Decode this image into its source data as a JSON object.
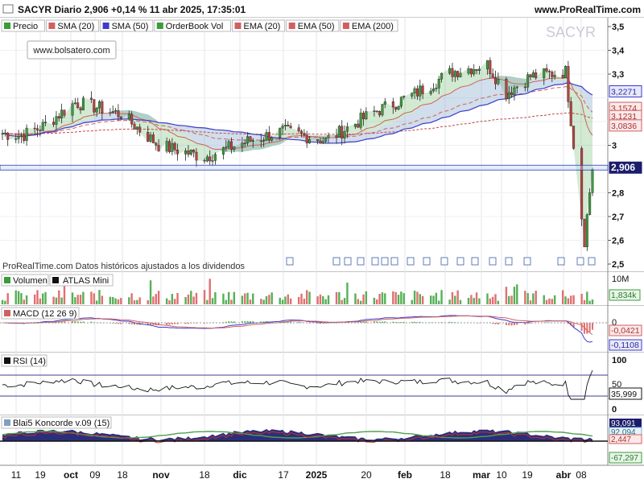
{
  "header": {
    "title": "SACYR Diario 2,906 +0,14 % 11 abr 2025, 17:35:01",
    "site": "www.ProRealTime.com"
  },
  "watermark": "SACYR",
  "source_box": "www.bolsatero.com",
  "disclaimer": "ProRealTime.com Datos históricos ajustados a los dividendos",
  "price_legend": [
    "Precio",
    "SMA (20)",
    "SMA (50)",
    "OrderBook Vol",
    "EMA (20)",
    "EMA (50)",
    "EMA (200)"
  ],
  "price_axis": {
    "ticks": [
      "3,5",
      "3,4",
      "3,3",
      "3",
      "2,8",
      "2,7",
      "2,6",
      "2,5"
    ],
    "badges": [
      "3,2271",
      "3,1574",
      "3,1231",
      "3,0836",
      "2,906"
    ]
  },
  "volume": {
    "legend": [
      "Volumen",
      "ATLAS Mini"
    ],
    "tick": "10M",
    "badge": "1,834k"
  },
  "macd": {
    "legend": "MACD (12 26 9)",
    "tick": "0",
    "badges": [
      "-0,0421",
      "-0,1108"
    ]
  },
  "rsi": {
    "legend": "RSI (14)",
    "ticks": [
      "100",
      "50",
      "0"
    ],
    "badge": "35,999"
  },
  "koncorde": {
    "legend": "Blai5 Koncorde v.09 (15)",
    "badges": [
      "93,091",
      "92,094",
      "2,447",
      "-67,297"
    ]
  },
  "x_axis": [
    "11",
    "19",
    "oct",
    "09",
    "18",
    "nov",
    "18",
    "dic",
    "17",
    "2025",
    "20",
    "feb",
    "18",
    "mar",
    "10",
    "19",
    "abr",
    "08"
  ],
  "colors": {
    "up": "#3c9b3c",
    "down": "#c04040",
    "sma50": "#3c3cc8",
    "ema": "#d06060",
    "price_badge": "#1c1c6c",
    "accent": "#2244aa"
  },
  "chart_data": {
    "type": "line",
    "title": "SACYR Diario",
    "series": [
      {
        "name": "Precio",
        "x": [
          "2024-09-11",
          "2024-09-19",
          "2024-10-01",
          "2024-10-09",
          "2024-10-18",
          "2024-11-01",
          "2024-11-18",
          "2024-12-02",
          "2024-12-17",
          "2025-01-02",
          "2025-01-20",
          "2025-02-03",
          "2025-02-18",
          "2025-03-03",
          "2025-03-10",
          "2025-03-19",
          "2025-04-01",
          "2025-04-08",
          "2025-04-11"
        ],
        "y": [
          3.04,
          3.08,
          3.18,
          3.16,
          3.13,
          3.0,
          2.95,
          3.01,
          3.06,
          3.02,
          3.14,
          3.21,
          3.31,
          3.34,
          3.22,
          3.29,
          3.31,
          2.6,
          2.906
        ]
      },
      {
        "name": "SMA (50)",
        "x": [
          "2024-09-11",
          "2024-10-18",
          "2024-11-18",
          "2024-12-17",
          "2025-01-20",
          "2025-02-18",
          "2025-03-19",
          "2025-04-11"
        ],
        "y": [
          3.1,
          3.12,
          3.06,
          3.03,
          3.07,
          3.15,
          3.24,
          3.2271
        ]
      },
      {
        "name": "EMA (200)",
        "x": [
          "2024-09-11",
          "2024-11-18",
          "2025-01-20",
          "2025-03-19",
          "2025-04-11"
        ],
        "y": [
          3.08,
          3.05,
          3.04,
          3.08,
          3.1231
        ]
      }
    ],
    "ylim": [
      2.5,
      3.5
    ],
    "panels": {
      "volume_last": "1,834k",
      "macd_last": [
        -0.0421,
        -0.1108
      ],
      "rsi_last": 35.999,
      "koncorde_last": [
        93.091,
        92.094,
        2.447,
        -67.297
      ]
    },
    "grid": true
  }
}
